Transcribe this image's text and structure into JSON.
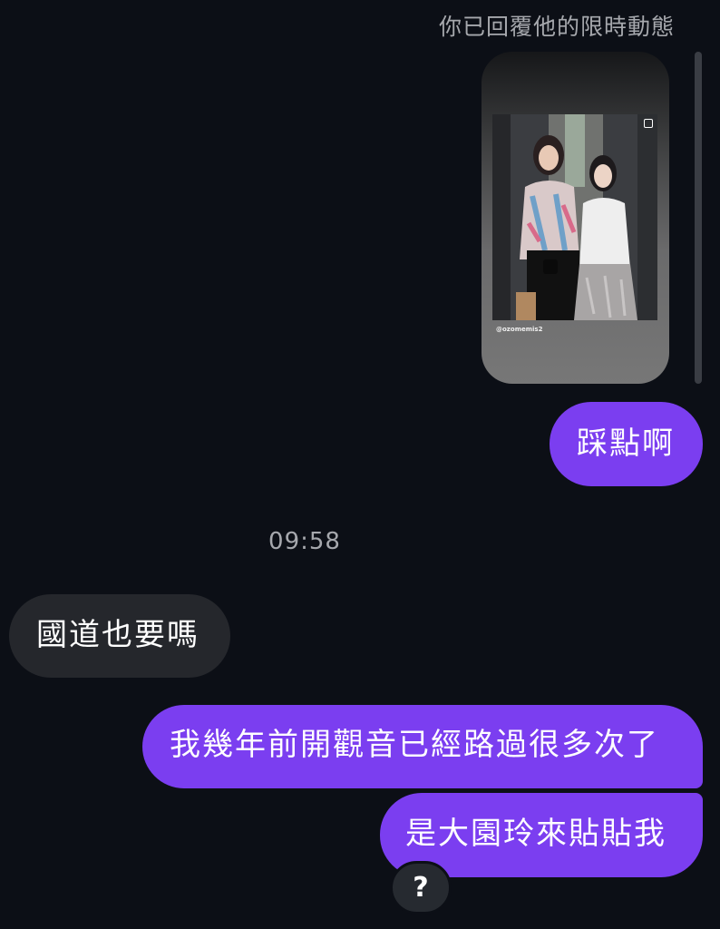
{
  "story_reply": {
    "label": "你已回覆他的限時動態",
    "emojis": "🥺🥺🥺",
    "handle": "@ozomemis2"
  },
  "messages": [
    {
      "direction": "outgoing",
      "text": "踩點啊"
    },
    {
      "direction": "incoming",
      "text": "國道也要嗎"
    },
    {
      "direction": "outgoing",
      "text": "我幾年前開觀音已經路過很多次了"
    },
    {
      "direction": "outgoing",
      "text": "是大園玲來貼貼我"
    }
  ],
  "timestamp": "09:58",
  "reaction": {
    "emoji": "?"
  },
  "colors": {
    "background": "#0c0f16",
    "outgoing_bubble": "#7b3ef0",
    "incoming_bubble": "#25272c",
    "secondary_text": "#a6a8ad"
  }
}
